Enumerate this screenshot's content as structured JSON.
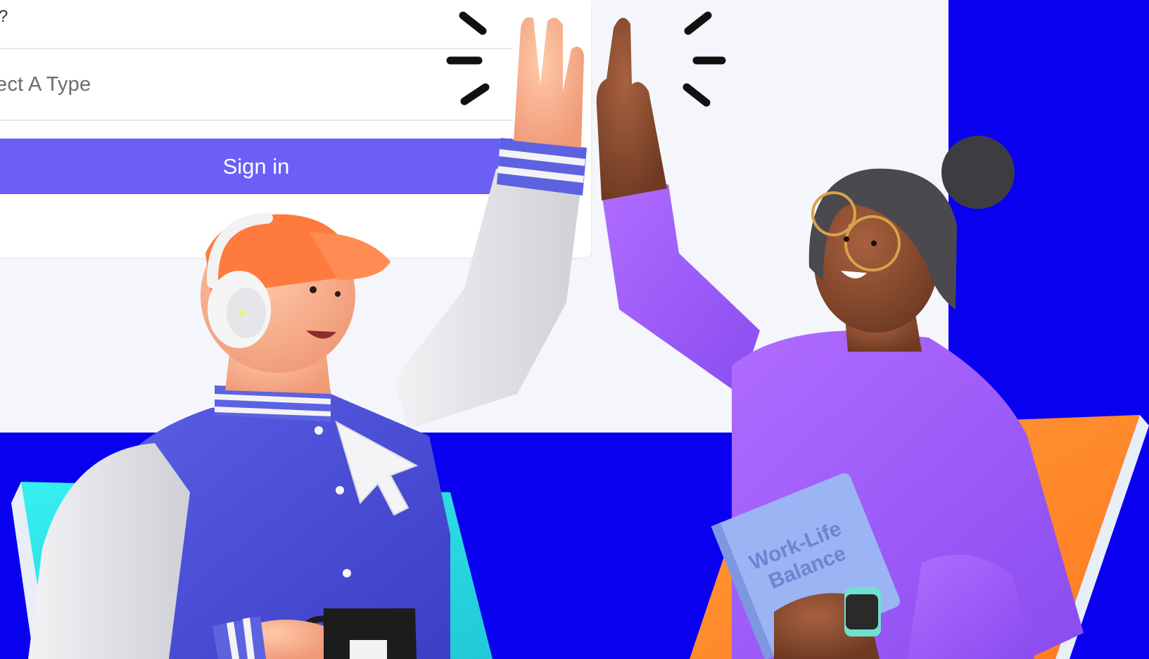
{
  "form": {
    "field_fragment": "?",
    "type_select": {
      "value": "ect A Type"
    },
    "sign_in_label": "Sign in"
  },
  "illustration": {
    "book_title": "Work-Life Balance",
    "icons": [
      "cursor-arrow-icon",
      "sparkle-lines-icon"
    ]
  },
  "colors": {
    "brand_blue": "#0a00f0",
    "primary_button": "#6c5ff6",
    "panel_bg": "#f4f6fb",
    "card_bg": "#ffffff",
    "cyan_accent": "#2ee6ea",
    "orange_accent": "#ff8a2a",
    "purple_sweater": "#9b5cff",
    "varsity_blue": "#4a4fd8",
    "cap_orange": "#ff7a3d"
  }
}
